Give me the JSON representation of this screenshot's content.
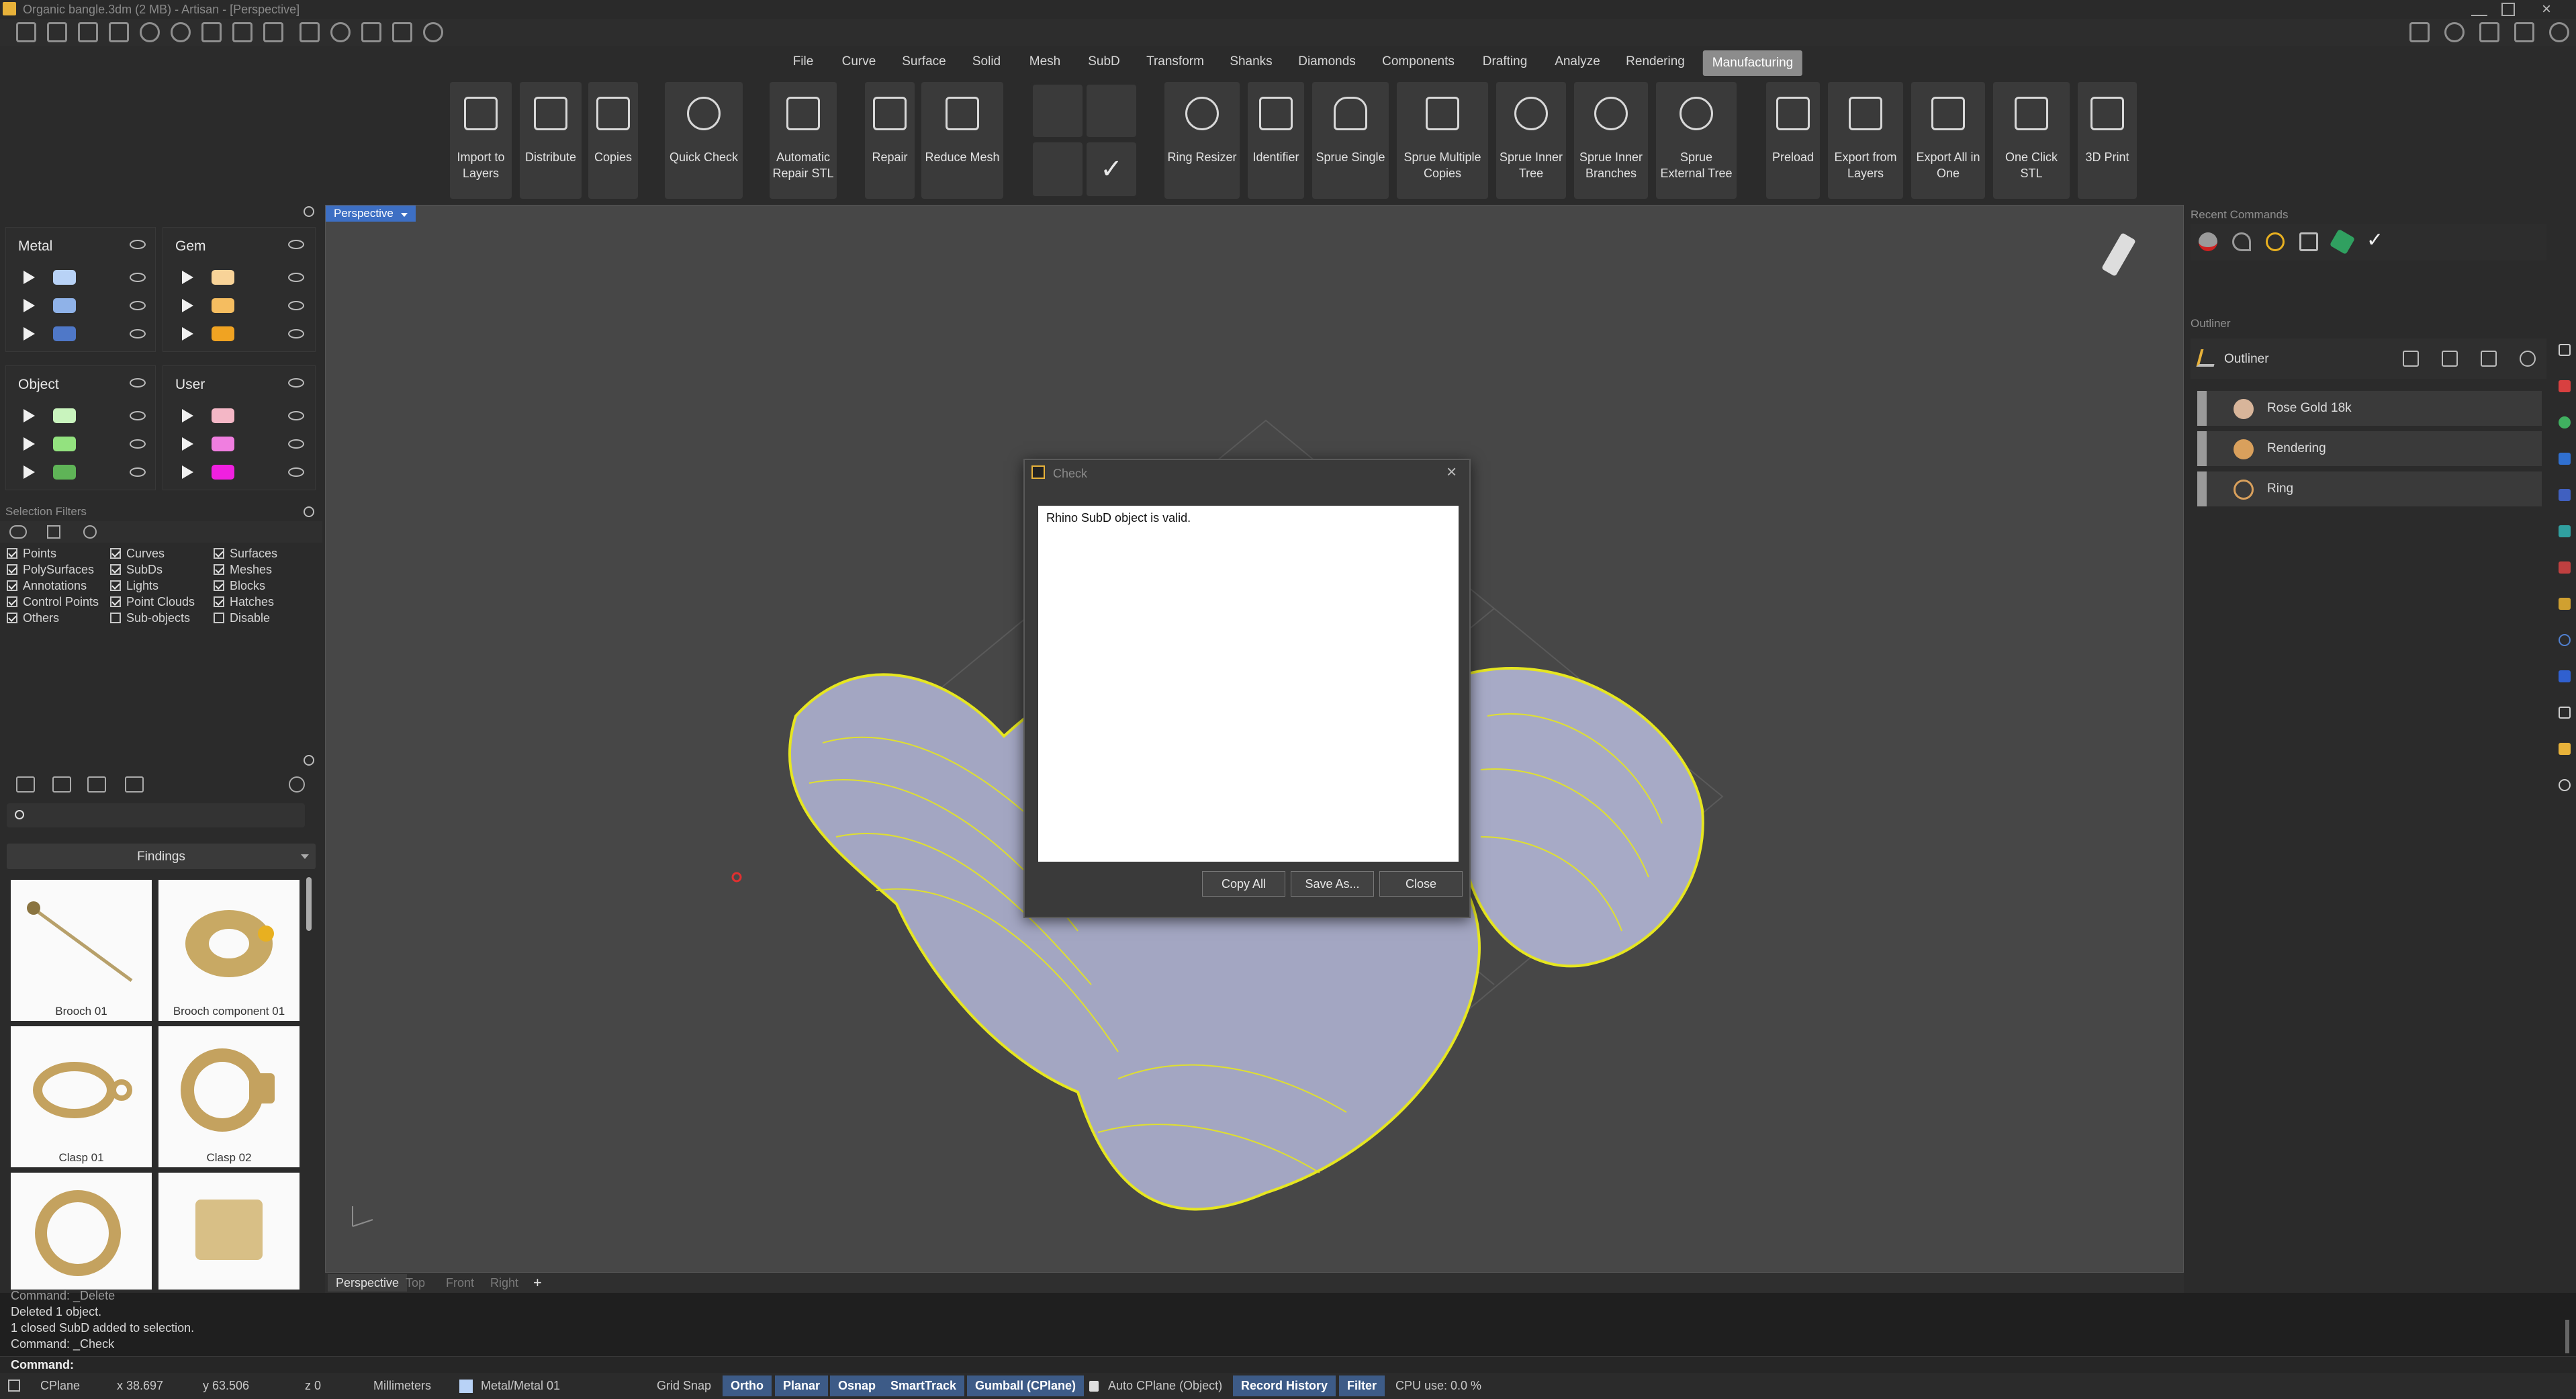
{
  "window": {
    "title": "Organic bangle.3dm (2 MB) - Artisan - [Perspective]"
  },
  "menu": [
    "File",
    "Curve",
    "Surface",
    "Solid",
    "Mesh",
    "SubD",
    "Transform",
    "Shanks",
    "Diamonds",
    "Components",
    "Drafting",
    "Analyze",
    "Rendering",
    "Manufacturing"
  ],
  "active_menu": "Manufacturing",
  "tools": [
    {
      "name": "import-to-layers",
      "label": "Import to Layers"
    },
    {
      "name": "distribute",
      "label": "Distribute"
    },
    {
      "name": "copies",
      "label": "Copies"
    },
    {
      "name": "quick-check",
      "label": "Quick Check"
    },
    {
      "name": "automatic-repair-stl",
      "label": "Automatic Repair STL"
    },
    {
      "name": "repair",
      "label": "Repair"
    },
    {
      "name": "reduce-mesh",
      "label": "Reduce Mesh"
    },
    {
      "name": "ring-resizer",
      "label": "Ring Resizer"
    },
    {
      "name": "identifier",
      "label": "Identifier"
    },
    {
      "name": "sprue-single",
      "label": "Sprue Single"
    },
    {
      "name": "sprue-multiple-copies",
      "label": "Sprue Multiple Copies"
    },
    {
      "name": "sprue-inner-tree",
      "label": "Sprue Inner Tree"
    },
    {
      "name": "sprue-inner-branches",
      "label": "Sprue Inner Branches"
    },
    {
      "name": "sprue-external-tree",
      "label": "Sprue External Tree"
    },
    {
      "name": "preload",
      "label": "Preload"
    },
    {
      "name": "export-from-layers",
      "label": "Export from Layers"
    },
    {
      "name": "export-all-in-one",
      "label": "Export All in One"
    },
    {
      "name": "one-click-stl",
      "label": "One Click STL"
    },
    {
      "name": "3d-print",
      "label": "3D Print"
    }
  ],
  "layers": {
    "groups": [
      {
        "name": "Metal",
        "colors": [
          "#b8d2f6",
          "#8fb2e8",
          "#4f78c8"
        ]
      },
      {
        "name": "Gem",
        "colors": [
          "#f8d398",
          "#f5bd60",
          "#f0a322"
        ]
      },
      {
        "name": "Object",
        "colors": [
          "#c9f4be",
          "#93e27f",
          "#5fb457"
        ]
      },
      {
        "name": "User",
        "colors": [
          "#f4b7c6",
          "#f07ee0",
          "#f020e0"
        ]
      }
    ]
  },
  "selection_filters": {
    "title": "Selection Filters",
    "items": [
      {
        "label": "Points",
        "checked": true
      },
      {
        "label": "Curves",
        "checked": true
      },
      {
        "label": "Surfaces",
        "checked": true
      },
      {
        "label": "PolySurfaces",
        "checked": true
      },
      {
        "label": "SubDs",
        "checked": true
      },
      {
        "label": "Meshes",
        "checked": true
      },
      {
        "label": "Annotations",
        "checked": true
      },
      {
        "label": "Lights",
        "checked": true
      },
      {
        "label": "Blocks",
        "checked": true
      },
      {
        "label": "Control Points",
        "checked": true
      },
      {
        "label": "Point Clouds",
        "checked": true
      },
      {
        "label": "Hatches",
        "checked": true
      },
      {
        "label": "Others",
        "checked": true
      },
      {
        "label": "Sub-objects",
        "checked": false
      },
      {
        "label": "Disable",
        "checked": false
      }
    ]
  },
  "library": {
    "category": "Findings",
    "items": [
      "Brooch 01",
      "Brooch component 01",
      "Clasp 01",
      "Clasp 02",
      "",
      ""
    ]
  },
  "viewport": {
    "active_tab": "Perspective",
    "tabs": [
      "Perspective",
      "Top",
      "Front",
      "Right"
    ],
    "add": "+"
  },
  "dialog": {
    "title": "Check",
    "message": "Rhino SubD object is valid.",
    "copy_all": "Copy All",
    "save_as": "Save As...",
    "close": "Close"
  },
  "recent_commands": {
    "title": "Recent Commands"
  },
  "outliner": {
    "panel_title": "Outliner",
    "header": "Outliner",
    "items": [
      "Rose Gold 18k",
      "Rendering",
      "Ring"
    ]
  },
  "command_history": [
    "Command: _Delete",
    "Deleted 1 object.",
    "1 closed SubD added to selection.",
    "Command: _Check"
  ],
  "command_prompt": "Command:",
  "status": {
    "cplane": "CPlane",
    "x": "x 38.697",
    "y": "y 63.506",
    "z": "z 0",
    "units": "Millimeters",
    "layer": "Metal/Metal 01",
    "grid_snap": "Grid Snap",
    "ortho": "Ortho",
    "planar": "Planar",
    "osnap": "Osnap",
    "smarttrack": "SmartTrack",
    "gumball": "Gumball (CPlane)",
    "auto_cplane": "Auto CPlane (Object)",
    "record_history": "Record History",
    "filter": "Filter",
    "cpu": "CPU use: 0.0 %"
  },
  "colors": {
    "accent": "#3d5b87",
    "active_tab": "#8c8c8c",
    "wire": "#e6e620"
  }
}
